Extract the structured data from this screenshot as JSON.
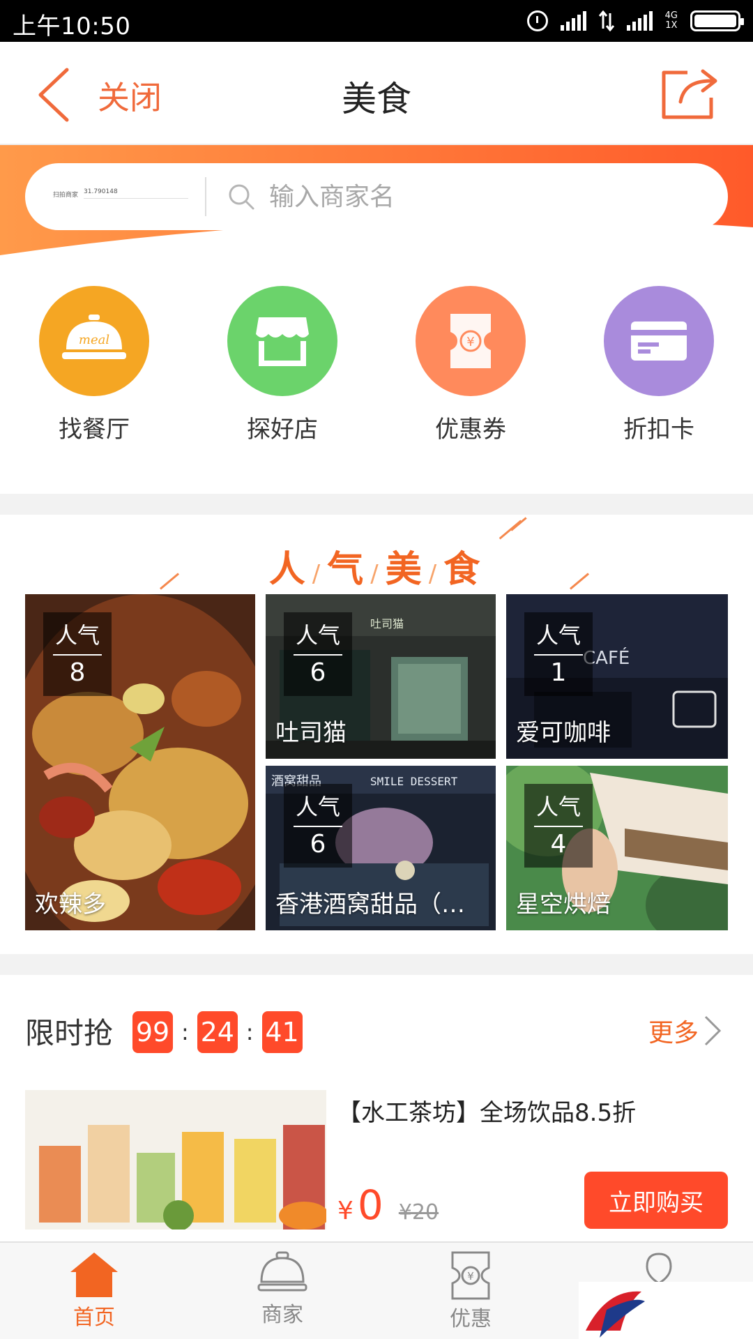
{
  "status_bar": {
    "time": "上午10:50",
    "net_top": "4G",
    "net_bottom": "1X"
  },
  "header": {
    "close_label": "关闭",
    "title": "美食"
  },
  "search": {
    "location_name": "扫拍商家",
    "location_value": "31.790148",
    "placeholder": "输入商家名"
  },
  "categories": [
    {
      "label": "找餐厅",
      "icon": "meal-cloche-icon",
      "color": "#f5a623",
      "icon_text": "meal"
    },
    {
      "label": "探好店",
      "icon": "storefront-icon",
      "color": "#6bd36b"
    },
    {
      "label": "优惠券",
      "icon": "coupon-icon",
      "color": "#ff8a5c"
    },
    {
      "label": "折扣卡",
      "icon": "discount-card-icon",
      "color": "#a98bdc"
    }
  ],
  "popular": {
    "title": [
      "人",
      "气",
      "美",
      "食"
    ],
    "badge_label": "人气",
    "items": [
      {
        "name": "欢辣多",
        "popularity": "8"
      },
      {
        "name": "吐司猫",
        "popularity": "6"
      },
      {
        "name": "爱可咖啡",
        "popularity": "1"
      },
      {
        "name": "香港酒窝甜品（…",
        "popularity": "6"
      },
      {
        "name": "星空烘焙",
        "popularity": "4"
      }
    ],
    "sign_text": {
      "toast_cat": "吐司猫",
      "cafe": "CAFÉ",
      "dessert": "SMILE DESSERT",
      "dessert_cn": "酒窝甜品"
    }
  },
  "flash_sale": {
    "title": "限时抢",
    "timer": [
      "99",
      "24",
      "41"
    ],
    "more_label": "更多",
    "deal": {
      "title": "【水工茶坊】全场饮品8.5折",
      "currency": "¥",
      "price": "0",
      "original_price": "¥20",
      "buy_label": "立即购买"
    }
  },
  "bottom_nav": [
    {
      "label": "首页",
      "icon": "home-icon",
      "active": true
    },
    {
      "label": "商家",
      "icon": "merchant-cloche-icon",
      "active": false
    },
    {
      "label": "优惠",
      "icon": "coupon-ticket-icon",
      "active": false
    }
  ],
  "colors": {
    "accent": "#f26522",
    "price": "#ff4a2a",
    "inactive": "#888888"
  }
}
